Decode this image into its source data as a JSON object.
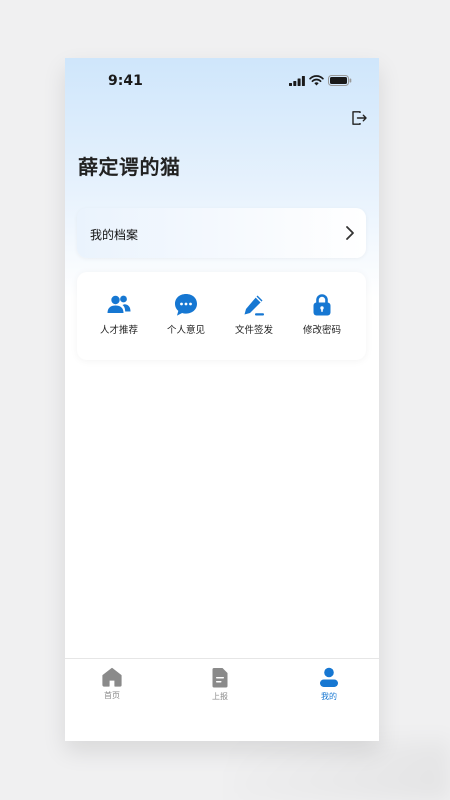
{
  "status_bar": {
    "time": "9:41"
  },
  "profile": {
    "name": "薛定谔的猫"
  },
  "archive": {
    "label": "我的档案"
  },
  "menu": {
    "items": [
      {
        "label": "人才推荐",
        "icon": "users-icon"
      },
      {
        "label": "个人意见",
        "icon": "chat-bubble-icon"
      },
      {
        "label": "文件签发",
        "icon": "pen-icon"
      },
      {
        "label": "修改密码",
        "icon": "lock-icon"
      }
    ]
  },
  "tabbar": {
    "tabs": [
      {
        "label": "首页",
        "icon": "home-icon",
        "active": false
      },
      {
        "label": "上报",
        "icon": "document-icon",
        "active": false
      },
      {
        "label": "我的",
        "icon": "person-icon",
        "active": true
      }
    ]
  },
  "colors": {
    "accent": "#1677d2",
    "inactive": "#8a8a8a"
  }
}
